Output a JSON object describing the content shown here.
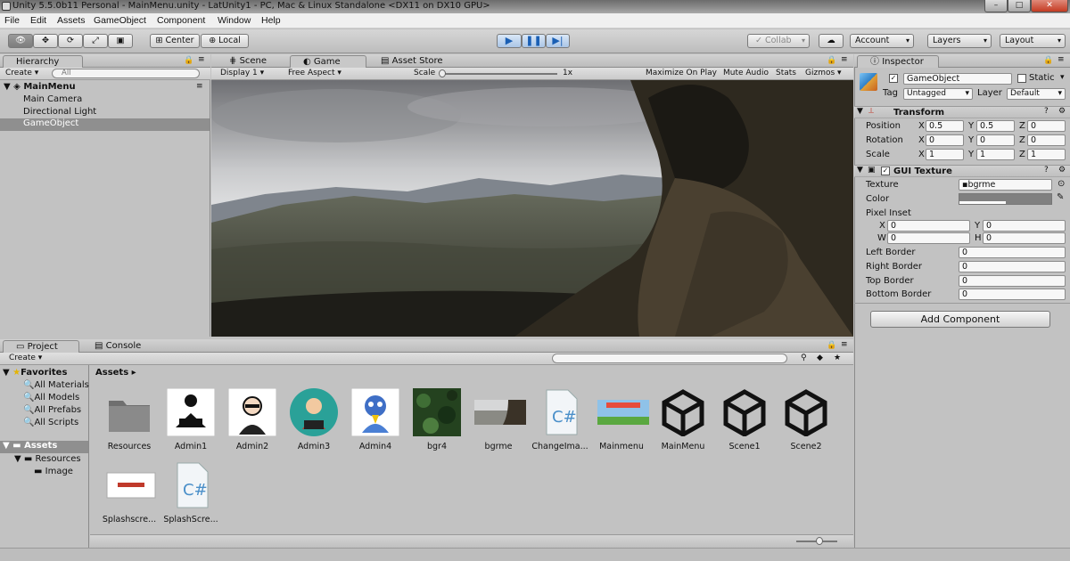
{
  "window": {
    "title": "Unity 5.5.0b11 Personal - MainMenu.unity - LatUnity1 - PC, Mac & Linux Standalone <DX11 on DX10 GPU>"
  },
  "menu": [
    "File",
    "Edit",
    "Assets",
    "GameObject",
    "Component",
    "Window",
    "Help"
  ],
  "toolbar": {
    "center": "Center",
    "local": "Local",
    "collab": "Collab",
    "account": "Account",
    "layers": "Layers",
    "layout": "Layout"
  },
  "hierarchy": {
    "tab": "Hierarchy",
    "create": "Create",
    "search_placeholder": "All",
    "scene": "MainMenu",
    "items": [
      "Main Camera",
      "Directional Light",
      "GameObject"
    ]
  },
  "center_tabs": {
    "scene": "Scene",
    "game": "Game",
    "asset_store": "Asset Store"
  },
  "game_bar": {
    "display": "Display 1",
    "aspect": "Free Aspect",
    "scale_label": "Scale",
    "scale_value": "1x",
    "maximize": "Maximize On Play",
    "mute": "Mute Audio",
    "stats": "Stats",
    "gizmos": "Gizmos"
  },
  "inspector": {
    "tab": "Inspector",
    "object_name": "GameObject",
    "static_label": "Static",
    "tag_label": "Tag",
    "tag_value": "Untagged",
    "layer_label": "Layer",
    "layer_value": "Default",
    "transform": {
      "title": "Transform",
      "position": {
        "label": "Position",
        "x": "0.5",
        "y": "0.5",
        "z": "0"
      },
      "rotation": {
        "label": "Rotation",
        "x": "0",
        "y": "0",
        "z": "0"
      },
      "scale": {
        "label": "Scale",
        "x": "1",
        "y": "1",
        "z": "1"
      }
    },
    "gui_texture": {
      "title": "GUI Texture",
      "texture_label": "Texture",
      "texture_value": "bgrme",
      "color_label": "Color",
      "pixel_inset_label": "Pixel Inset",
      "pi_x": "0",
      "pi_y": "0",
      "pi_w": "0",
      "pi_h": "0",
      "left_border_label": "Left Border",
      "left_border": "0",
      "right_border_label": "Right Border",
      "right_border": "0",
      "top_border_label": "Top Border",
      "top_border": "0",
      "bottom_border_label": "Bottom Border",
      "bottom_border": "0"
    },
    "add_component": "Add Component",
    "axis": {
      "x": "X",
      "y": "Y",
      "z": "Z",
      "w": "W",
      "h": "H"
    }
  },
  "project": {
    "tab": "Project",
    "console_tab": "Console",
    "create": "Create",
    "favorites": {
      "label": "Favorites",
      "items": [
        "All Materials",
        "All Models",
        "All Prefabs",
        "All Scripts"
      ]
    },
    "assets_tree": {
      "label": "Assets",
      "resources": "Resources",
      "image": "Image"
    },
    "breadcrumb": "Assets",
    "assets": [
      "Resources",
      "Admin1",
      "Admin2",
      "Admin3",
      "Admin4",
      "bgr4",
      "bgrme",
      "ChangeIma...",
      "Mainmenu",
      "MainMenu",
      "Scene1",
      "Scene2",
      "Splashscre...",
      "SplashScre..."
    ]
  }
}
